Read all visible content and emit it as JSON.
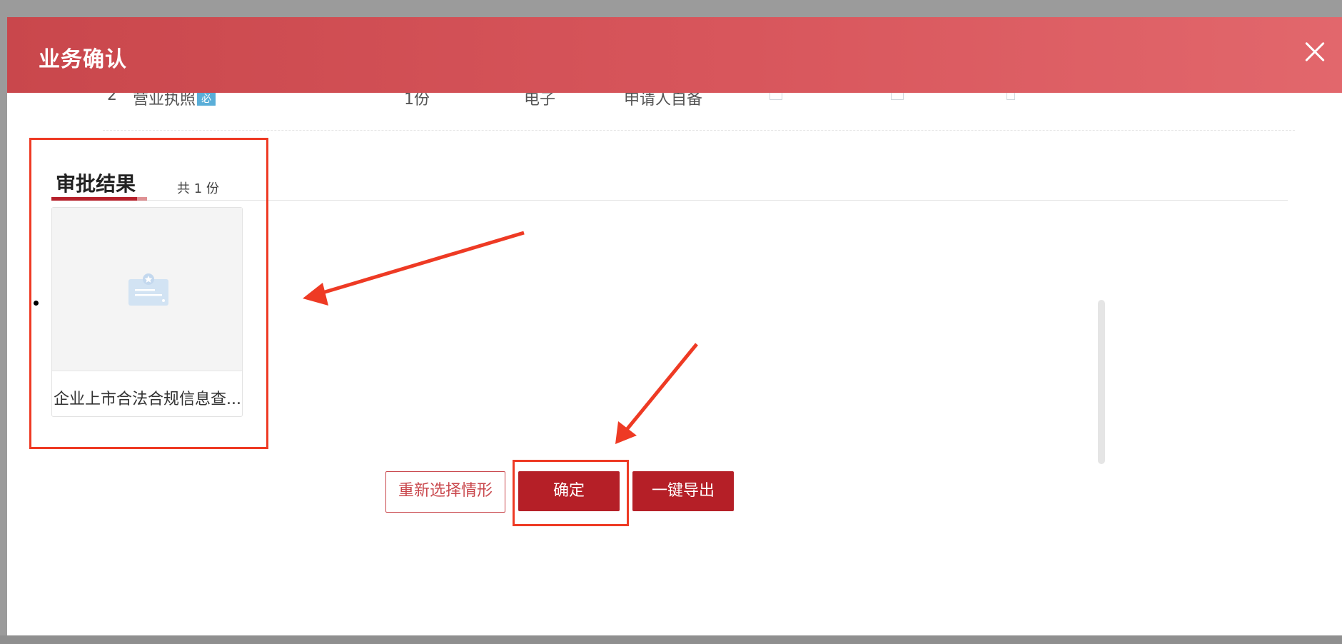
{
  "modal": {
    "title": "业务确认",
    "close_icon": "close-icon"
  },
  "cut_row": {
    "index": "2",
    "name": "营业执照",
    "tag": "必",
    "count": "1份",
    "type": "电子",
    "source": "申请人自备"
  },
  "section": {
    "title": "审批结果",
    "count": "共 1 份"
  },
  "result_card": {
    "name": "企业上市合法合规信息查...",
    "icon": "certificate-icon"
  },
  "buttons": {
    "reselect_label": "重新选择情形",
    "confirm_label": "确定",
    "export_label": "一键导出"
  },
  "colors": {
    "header_start": "#c9474c",
    "header_end": "#e2676c",
    "primary_button": "#b51f27",
    "annotation": "#ee3a24"
  }
}
